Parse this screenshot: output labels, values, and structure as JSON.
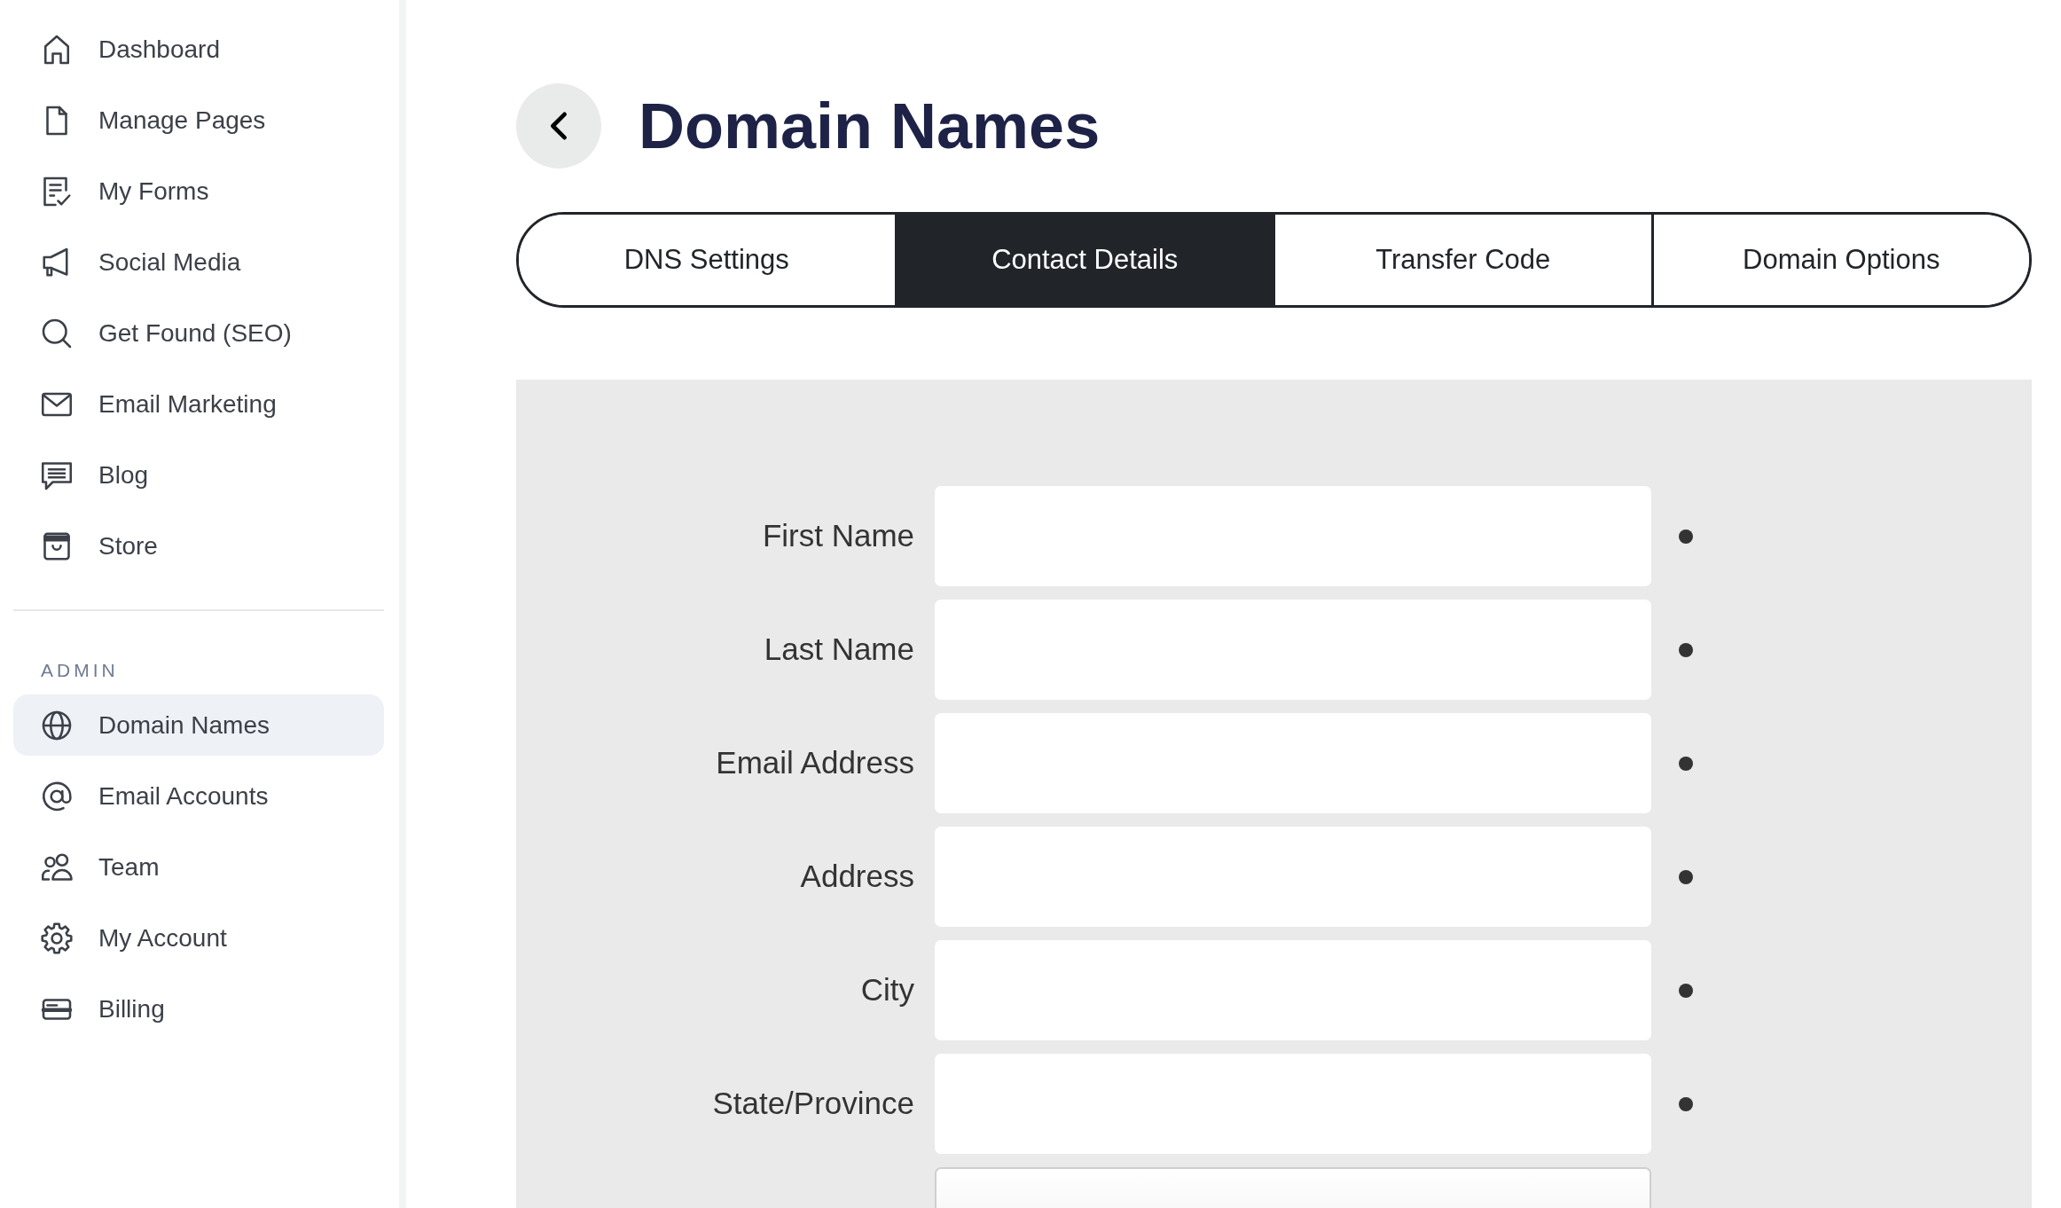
{
  "sidebar": {
    "items": [
      {
        "label": "Dashboard",
        "selected": false
      },
      {
        "label": "Manage Pages",
        "selected": false
      },
      {
        "label": "My Forms",
        "selected": false
      },
      {
        "label": "Social Media",
        "selected": false
      },
      {
        "label": "Get Found (SEO)",
        "selected": false
      },
      {
        "label": "Email Marketing",
        "selected": false
      },
      {
        "label": "Blog",
        "selected": false
      },
      {
        "label": "Store",
        "selected": false
      }
    ],
    "admin": {
      "heading": "ADMIN",
      "items": [
        {
          "label": "Domain Names",
          "selected": true
        },
        {
          "label": "Email Accounts",
          "selected": false
        },
        {
          "label": "Team",
          "selected": false
        },
        {
          "label": "My Account",
          "selected": false
        },
        {
          "label": "Billing",
          "selected": false
        }
      ]
    }
  },
  "page": {
    "title": "Domain Names"
  },
  "tabs": [
    {
      "label": "DNS Settings",
      "selected": false
    },
    {
      "label": "Contact Details",
      "selected": true
    },
    {
      "label": "Transfer Code",
      "selected": false
    },
    {
      "label": "Domain Options",
      "selected": false
    }
  ],
  "form": {
    "fields": [
      {
        "kind": "text",
        "label": "First Name",
        "required": true
      },
      {
        "kind": "text",
        "label": "Last Name",
        "required": true
      },
      {
        "kind": "text",
        "label": "Email Address",
        "required": true
      },
      {
        "kind": "text",
        "label": "Address",
        "required": true
      },
      {
        "kind": "text",
        "label": "City",
        "required": true
      },
      {
        "kind": "text",
        "label": "State/Province",
        "required": true
      },
      {
        "kind": "select"
      }
    ]
  }
}
